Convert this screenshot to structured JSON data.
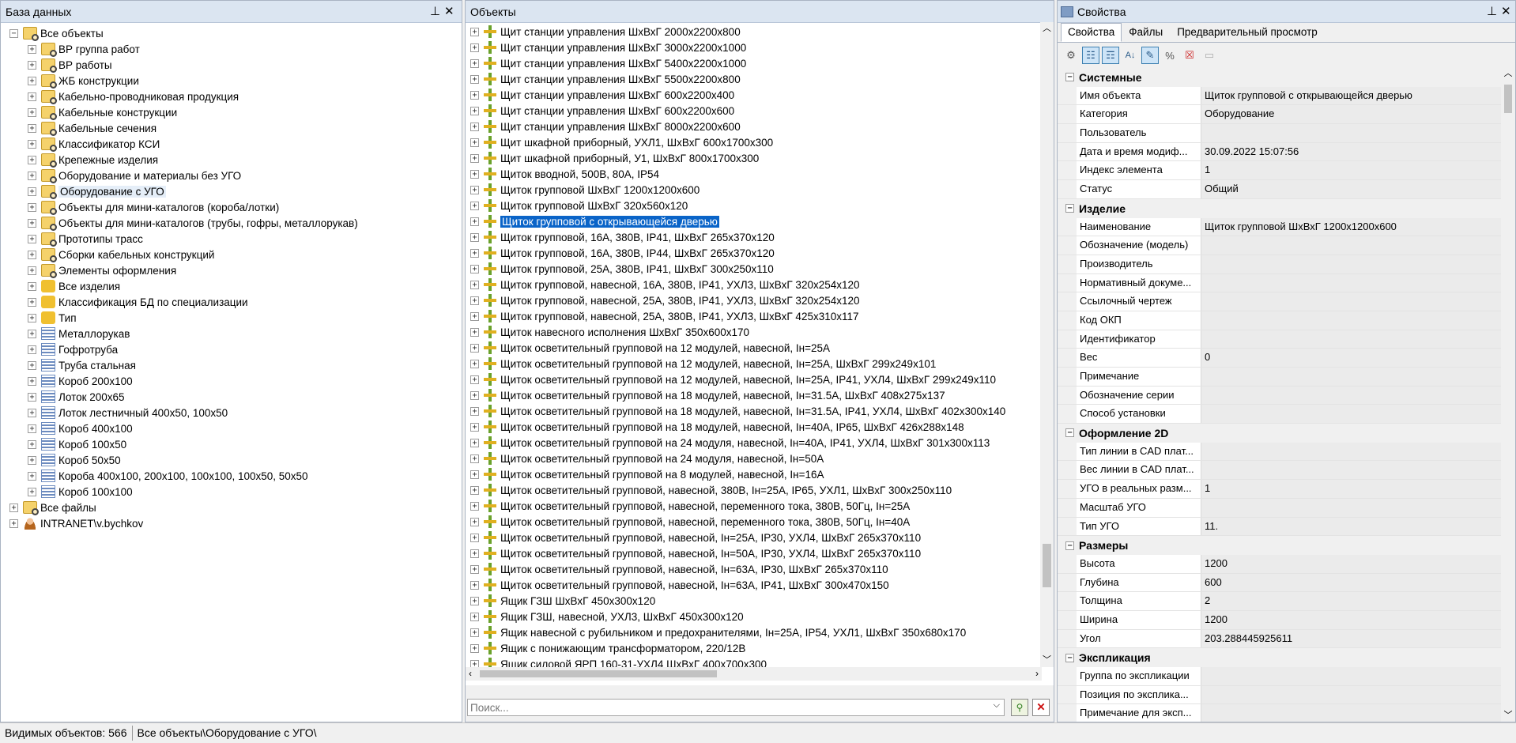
{
  "left_panel": {
    "title": "База данных",
    "items": [
      {
        "label": "Все объекты",
        "level": 0,
        "icon": "folder-icon",
        "expander": "−"
      },
      {
        "label": "ВР группа работ",
        "level": 1,
        "icon": "folder-icon",
        "expander": "+"
      },
      {
        "label": "ВР работы",
        "level": 1,
        "icon": "folder-icon",
        "expander": "+"
      },
      {
        "label": "ЖБ конструкции",
        "level": 1,
        "icon": "folder-icon",
        "expander": "+"
      },
      {
        "label": "Кабельно-проводниковая продукция",
        "level": 1,
        "icon": "folder-icon",
        "expander": "+"
      },
      {
        "label": "Кабельные конструкции",
        "level": 1,
        "icon": "folder-icon",
        "expander": "+"
      },
      {
        "label": "Кабельные сечения",
        "level": 1,
        "icon": "folder-icon",
        "expander": "+"
      },
      {
        "label": "Классификатор КСИ",
        "level": 1,
        "icon": "folder-icon",
        "expander": "+"
      },
      {
        "label": "Крепежные изделия",
        "level": 1,
        "icon": "folder-icon",
        "expander": "+"
      },
      {
        "label": "Оборудование и материалы без УГО",
        "level": 1,
        "icon": "folder-icon",
        "expander": "+"
      },
      {
        "label": "Оборудование с УГО",
        "level": 1,
        "icon": "folder-icon",
        "expander": "+",
        "highlighted": true
      },
      {
        "label": "Объекты для мини-каталогов (короба/лотки)",
        "level": 1,
        "icon": "folder-icon",
        "expander": "+"
      },
      {
        "label": "Объекты для мини-каталогов (трубы, гофры, металлорукав)",
        "level": 1,
        "icon": "folder-icon",
        "expander": "+"
      },
      {
        "label": "Прототипы трасс",
        "level": 1,
        "icon": "folder-icon",
        "expander": "+"
      },
      {
        "label": "Сборки кабельных конструкций",
        "level": 1,
        "icon": "folder-icon",
        "expander": "+"
      },
      {
        "label": "Элементы оформления",
        "level": 1,
        "icon": "folder-icon",
        "expander": "+"
      },
      {
        "label": "Все изделия",
        "level": 1,
        "icon": "puzzle-icon",
        "expander": "+"
      },
      {
        "label": "Классификация БД по специализации",
        "level": 1,
        "icon": "puzzle-icon",
        "expander": "+"
      },
      {
        "label": "Тип",
        "level": 1,
        "icon": "puzzle-icon",
        "expander": "+"
      },
      {
        "label": "Металлорукав",
        "level": 1,
        "icon": "list-icon",
        "expander": "+"
      },
      {
        "label": "Гофротруба",
        "level": 1,
        "icon": "list-icon",
        "expander": "+"
      },
      {
        "label": "Труба стальная",
        "level": 1,
        "icon": "list-icon",
        "expander": "+"
      },
      {
        "label": "Короб 200х100",
        "level": 1,
        "icon": "list-icon",
        "expander": "+"
      },
      {
        "label": "Лоток 200х65",
        "level": 1,
        "icon": "list-icon",
        "expander": "+"
      },
      {
        "label": "Лоток лестничный 400х50, 100х50",
        "level": 1,
        "icon": "list-icon",
        "expander": "+"
      },
      {
        "label": "Короб 400х100",
        "level": 1,
        "icon": "list-icon",
        "expander": "+"
      },
      {
        "label": "Короб 100х50",
        "level": 1,
        "icon": "list-icon",
        "expander": "+"
      },
      {
        "label": "Короб 50х50",
        "level": 1,
        "icon": "list-icon",
        "expander": "+"
      },
      {
        "label": "Короба 400х100, 200х100, 100х100, 100х50, 50х50",
        "level": 1,
        "icon": "list-icon",
        "expander": "+"
      },
      {
        "label": "Короб 100х100",
        "level": 1,
        "icon": "list-icon",
        "expander": "+"
      },
      {
        "label": "Все файлы",
        "level": 0,
        "icon": "folder-icon",
        "expander": "+"
      },
      {
        "label": "INTRANET\\v.bychkov",
        "level": 0,
        "icon": "user-icon",
        "expander": "+"
      }
    ]
  },
  "middle_panel": {
    "title": "Объекты",
    "items": [
      "Щит станции управления ШхВхГ 2000х2200х800",
      "Щит станции управления ШхВхГ 3000х2200х1000",
      "Щит станции управления ШхВхГ 5400х2200х1000",
      "Щит станции управления ШхВхГ 5500х2200х800",
      "Щит станции управления ШхВхГ 600х2200х400",
      "Щит станции управления ШхВхГ 600х2200х600",
      "Щит станции управления ШхВхГ 8000х2200х600",
      "Щит шкафной приборный, УХЛ1, ШхВхГ 600х1700х300",
      "Щит шкафной приборный, У1, ШхВхГ 800х1700х300",
      "Щиток вводной, 500В, 80А, IP54",
      "Щиток групповой ШхВхГ 1200х1200х600",
      "Щиток групповой ШхВхГ 320х560х120",
      "Щиток групповой с открывающейся дверью",
      "Щиток групповой, 16А, 380В, IP41, ШхВхГ 265х370х120",
      "Щиток групповой, 16А, 380В, IP44, ШхВхГ 265х370х120",
      "Щиток групповой, 25А, 380В, IP41, ШхВхГ 300х250х110",
      "Щиток групповой, навесной, 16А, 380В, IP41, УХЛ3, ШхВхГ 320х254х120",
      "Щиток групповой, навесной, 25А, 380В, IP41, УХЛ3, ШхВхГ 320х254х120",
      "Щиток групповой, навесной, 25А, 380В, IP41, УХЛ3, ШхВхГ 425х310х117",
      "Щиток навесного исполнения ШхВхГ 350х600х170",
      "Щиток осветительный групповой на 12 модулей, навесной, Iн=25А",
      "Щиток осветительный групповой на 12 модулей, навесной, Iн=25А, ШхВхГ 299х249х101",
      "Щиток осветительный групповой на 12 модулей, навесной, Iн=25А, IP41, УХЛ4, ШхВхГ 299х249х110",
      "Щиток осветительный групповой на 18 модулей, навесной, Iн=31.5А, ШхВхГ 408х275х137",
      "Щиток осветительный групповой на 18 модулей, навесной, Iн=31.5А, IP41, УХЛ4, ШхВхГ 402х300х140",
      "Щиток осветительный групповой на 18 модулей, навесной, Iн=40А, IP65, ШхВхГ 426х288х148",
      "Щиток осветительный групповой на 24 модуля, навесной, Iн=40А, IP41, УХЛ4, ШхВхГ 301х300х113",
      "Щиток осветительный групповой на 24 модуля, навесной, Iн=50А",
      "Щиток осветительный групповой на 8 модулей, навесной, Iн=16А",
      "Щиток осветительный групповой, навесной, 380В, Iн=25А, IP65, УХЛ1, ШхВхГ 300х250х110",
      "Щиток осветительный групповой, навесной, переменного тока, 380В, 50Гц, Iн=25А",
      "Щиток осветительный групповой, навесной, переменного тока, 380В, 50Гц, Iн=40А",
      "Щиток осветительный групповой, навесной, Iн=25А, IP30, УХЛ4, ШхВхГ 265х370х110",
      "Щиток осветительный групповой, навесной, Iн=50А, IP30, УХЛ4, ШхВхГ 265х370х110",
      "Щиток осветительный групповой, навесной, Iн=63А, IP30, ШхВхГ 265х370х110",
      "Щиток осветительный групповой, навесной, Iн=63А, IP41, ШхВхГ 300х470х150",
      "Ящик ГЗШ ШхВхГ 450х300х120",
      "Ящик ГЗШ,  навесной, УХЛ3, ШхВхГ 450х300х120",
      "Ящик навесной с рубильником и предохранителями, Iн=25А, IP54, УХЛ1, ШхВхГ 350х680х170",
      "Ящик с понижающим трансформатором, 220/12В",
      "Ящик силовой ЯРП 160-31-УХЛ4 ШхВхГ 400х700х300"
    ],
    "selected_index": 12,
    "search": {
      "placeholder": "Поиск...",
      "value": ""
    }
  },
  "right_panel": {
    "title": "Свойства",
    "tabs": [
      "Свойства",
      "Файлы",
      "Предварительный просмотр"
    ],
    "active_tab": 0,
    "sections": [
      {
        "name": "Системные",
        "rows": [
          {
            "name": "Имя объекта",
            "value": "Щиток групповой с открывающейся дверью"
          },
          {
            "name": "Категория",
            "value": "Оборудование"
          },
          {
            "name": "Пользователь",
            "value": ""
          },
          {
            "name": "Дата и время модиф...",
            "value": "30.09.2022 15:07:56"
          },
          {
            "name": "Индекс элемента",
            "value": "1"
          },
          {
            "name": "Статус",
            "value": "Общий"
          }
        ]
      },
      {
        "name": "Изделие",
        "rows": [
          {
            "name": "Наименование",
            "value": "Щиток групповой ШхВхГ 1200х1200х600"
          },
          {
            "name": "Обозначение (модель)",
            "value": ""
          },
          {
            "name": "Производитель",
            "value": ""
          },
          {
            "name": "Нормативный докуме...",
            "value": ""
          },
          {
            "name": "Ссылочный чертеж",
            "value": ""
          },
          {
            "name": "Код ОКП",
            "value": ""
          },
          {
            "name": "Идентификатор",
            "value": ""
          },
          {
            "name": "Вес",
            "value": "0"
          },
          {
            "name": "Примечание",
            "value": ""
          },
          {
            "name": "Обозначение серии",
            "value": ""
          },
          {
            "name": "Способ установки",
            "value": ""
          }
        ]
      },
      {
        "name": "Оформление 2D",
        "rows": [
          {
            "name": "Тип линии в CAD плат...",
            "value": ""
          },
          {
            "name": "Вес линии в CAD плат...",
            "value": ""
          },
          {
            "name": "УГО в реальных разм...",
            "value": "1"
          },
          {
            "name": "Масштаб УГО",
            "value": ""
          },
          {
            "name": "Тип УГО",
            "value": "11."
          }
        ]
      },
      {
        "name": "Размеры",
        "rows": [
          {
            "name": "Высота",
            "value": "1200"
          },
          {
            "name": "Глубина",
            "value": "600"
          },
          {
            "name": "Толщина",
            "value": "2"
          },
          {
            "name": "Ширина",
            "value": "1200"
          },
          {
            "name": "Угол",
            "value": "203.288445925611"
          }
        ]
      },
      {
        "name": "Экспликация",
        "rows": [
          {
            "name": "Группа по экспликации",
            "value": ""
          },
          {
            "name": "Позиция по эксплика...",
            "value": ""
          },
          {
            "name": "Примечание для эксп...",
            "value": ""
          }
        ]
      }
    ]
  },
  "status_bar": {
    "visible_count": "Видимых объектов: 566",
    "path": "Все объекты\\Оборудование с УГО\\"
  }
}
